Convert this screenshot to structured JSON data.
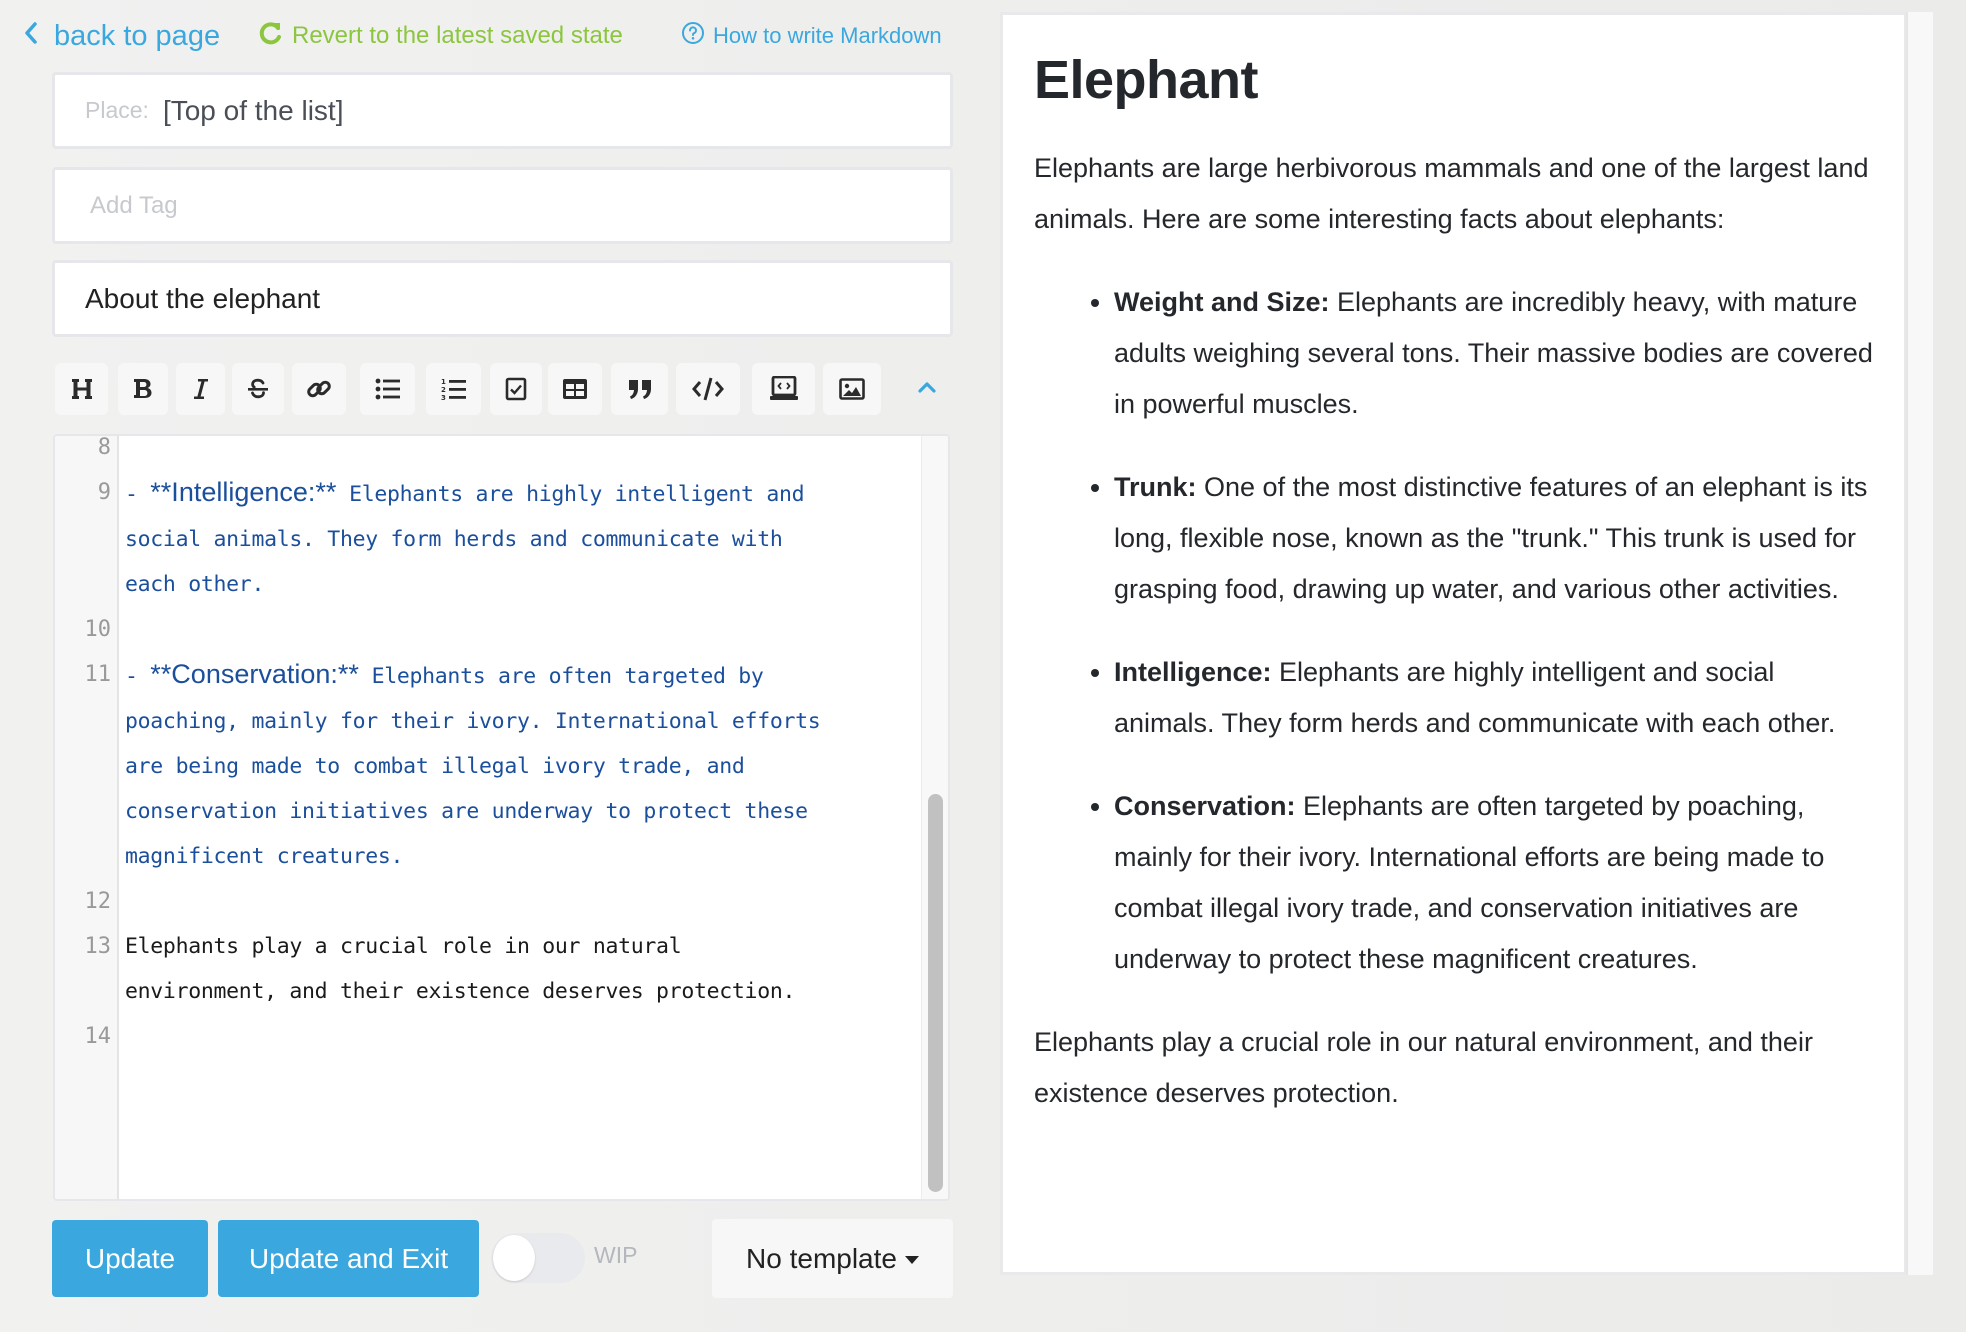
{
  "header": {
    "back_label": "back to page",
    "revert_label": "Revert to the latest saved state",
    "help_label": "How to write Markdown",
    "colors": {
      "link": "#3aa8df",
      "revert": "#8cc63f"
    }
  },
  "form": {
    "place_label": "Place:",
    "place_value": "[Top of the list]",
    "tag_placeholder": "Add Tag",
    "title_value": "About the elephant"
  },
  "toolbar": {
    "buttons": [
      {
        "name": "heading",
        "icon": "heading-icon"
      },
      {
        "name": "bold",
        "icon": "bold-icon"
      },
      {
        "name": "italic",
        "icon": "italic-icon"
      },
      {
        "name": "strikethrough",
        "icon": "strikethrough-icon"
      },
      {
        "name": "link",
        "icon": "link-icon"
      },
      {
        "name": "bulleted-list",
        "icon": "bulleted-list-icon"
      },
      {
        "name": "numbered-list",
        "icon": "numbered-list-icon"
      },
      {
        "name": "checkbox",
        "icon": "checkbox-icon"
      },
      {
        "name": "table",
        "icon": "table-icon"
      },
      {
        "name": "quote",
        "icon": "quote-icon"
      },
      {
        "name": "code",
        "icon": "code-icon"
      },
      {
        "name": "embed",
        "icon": "embed-icon"
      },
      {
        "name": "image",
        "icon": "image-icon"
      }
    ],
    "collapse_icon": "chevron-up-icon"
  },
  "editor": {
    "lines": [
      {
        "num": "8",
        "segments": []
      },
      {
        "num": "9",
        "style": "blue",
        "wraps": [
          {
            "pre": "- ",
            "strong": "**Intelligence:**",
            "text": " Elephants are highly intelligent and"
          },
          {
            "text": "social animals. They form herds and communicate with"
          },
          {
            "text": "each other."
          }
        ]
      },
      {
        "num": "10",
        "segments": []
      },
      {
        "num": "11",
        "style": "blue",
        "wraps": [
          {
            "pre": "- ",
            "strong": "**Conservation:**",
            "text": " Elephants are often targeted by"
          },
          {
            "text": "poaching, mainly for their ivory. International efforts"
          },
          {
            "text": "are being made to combat illegal ivory trade, and"
          },
          {
            "text": "conservation initiatives are underway to protect these"
          },
          {
            "text": "magnificent creatures."
          }
        ]
      },
      {
        "num": "12",
        "segments": []
      },
      {
        "num": "13",
        "style": "black",
        "wraps": [
          {
            "text": "Elephants play a crucial role in our natural"
          },
          {
            "text": "environment, and their existence deserves protection."
          }
        ]
      },
      {
        "num": "14",
        "segments": []
      }
    ]
  },
  "footer": {
    "update_label": "Update",
    "update_exit_label": "Update and Exit",
    "wip_label": "WIP",
    "wip_on": false,
    "template_label": "No template"
  },
  "preview": {
    "title": "Elephant",
    "intro": "Elephants are large herbivorous mammals and one of the largest land animals. Here are some interesting facts about elephants:",
    "facts": [
      {
        "term": "Weight and Size:",
        "text": " Elephants are incredibly heavy, with mature adults weighing several tons. Their massive bodies are covered in powerful muscles."
      },
      {
        "term": "Trunk:",
        "text": " One of the most distinctive features of an elephant is its long, flexible nose, known as the \"trunk.\" This trunk is used for grasping food, drawing up water, and various other activities."
      },
      {
        "term": "Intelligence:",
        "text": " Elephants are highly intelligent and social animals. They form herds and communicate with each other."
      },
      {
        "term": "Conservation:",
        "text": " Elephants are often targeted by poaching, mainly for their ivory. International efforts are being made to combat illegal ivory trade, and conservation initiatives are underway to protect these magnificent creatures."
      }
    ],
    "closing": "Elephants play a crucial role in our natural environment, and their existence deserves protection."
  }
}
